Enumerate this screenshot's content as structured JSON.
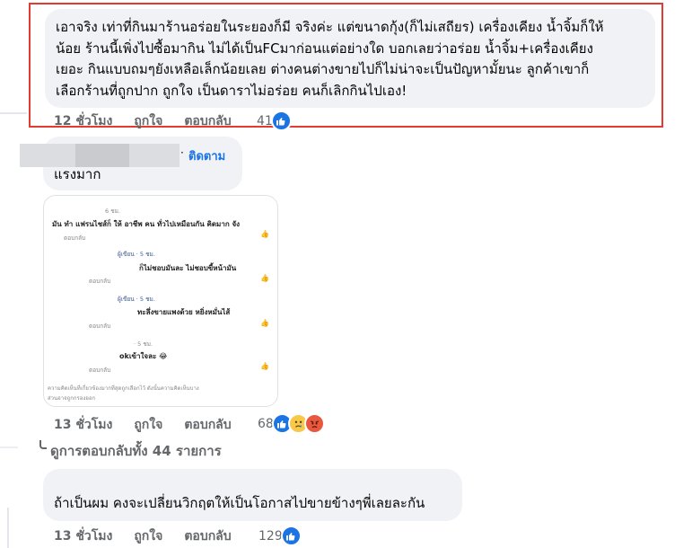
{
  "comment1": {
    "lines": [
      "เอาจริง เท่าที่กินมาร้านอร่อยในระยองก็มี จริงค่ะ แต่ขนาดกุ้ง(ก็ไม่เสถียร) เครื่องเคียง น้ำจิ้มก็ให้",
      "น้อย ร้านนี้เพิ่งไปซื้อมากิน ไม่ได้เป็นFCมาก่อนแต่อย่างใด บอกเลยว่าอร่อย น้ำจิ้ม+เครื่องเคียง",
      "เยอะ กินแบบถมๆยังเหลือเล็กน้อยเลย ต่างคนต่างขายไปก็ไม่น่าจะเป็นปัญหามั้ยนะ ลูกค้าเขาก็",
      "เลือกร้านที่ถูกปาก ถูกใจ เป็นดาราไม่อร่อย คนก็เลิกกินไปเอง!"
    ],
    "time": "12 ชั่วโมง",
    "like": "ถูกใจ",
    "reply": "ตอบกลับ",
    "reaction_count": "41"
  },
  "comment2": {
    "follow": "ติดตาม",
    "text": "แรงมาก",
    "time": "13 ชั่วโมง",
    "like": "ถูกใจ",
    "reply": "ตอบกลับ",
    "reaction_count": "68",
    "screenshot": {
      "t1": "6 ชม.",
      "c1": "มัน ทำ แฟรนไชส์ก็ ให้ อาชีพ คน ทั่วไปเหมือนกัน คิดมาก จัง",
      "r1": "ตอบกลับ",
      "a2": "ผู้เขียน · 5 ชม.",
      "c2": "ก็ไม่ชอบมันละ ไม่ชอบขี้หน้ามัน",
      "r2": "ตอบกลับ",
      "a3": "ผู้เขียน · 5 ชม.",
      "c3": "ทะลึ่งขายแพงด้วย หยิ่งหมั่นไส้",
      "r3": "ตอบกลับ",
      "t4": "· 5 ชม.",
      "c4": "okเข้าใจละ 😂",
      "r4": "ตอบกลับ",
      "footer1": "ความคิดเห็นที่เกี่ยวข้องมากที่สุดถูกเลือกไว้ ดังนั้นความคิดเห็นบาง",
      "footer2": "ส่วนอาจถูกกรองออก"
    }
  },
  "view_all_replies": "ดูการตอบกลับทั้ง 44 รายการ",
  "comment3": {
    "text": "ถ้าเป็นผม คงจะเปลี่ยนวิกฤตให้เป็นโอกาสไปขายข้างๆพี่เลยละกัน",
    "time": "13 ชั่วโมง",
    "like": "ถูกใจ",
    "reply": "ตอบกลับ",
    "reaction_count": "129"
  },
  "colors": {
    "bubble": "#f0f2f5",
    "highlight_border": "#e03c31",
    "link_blue": "#1b74e4",
    "muted": "#65676b"
  }
}
